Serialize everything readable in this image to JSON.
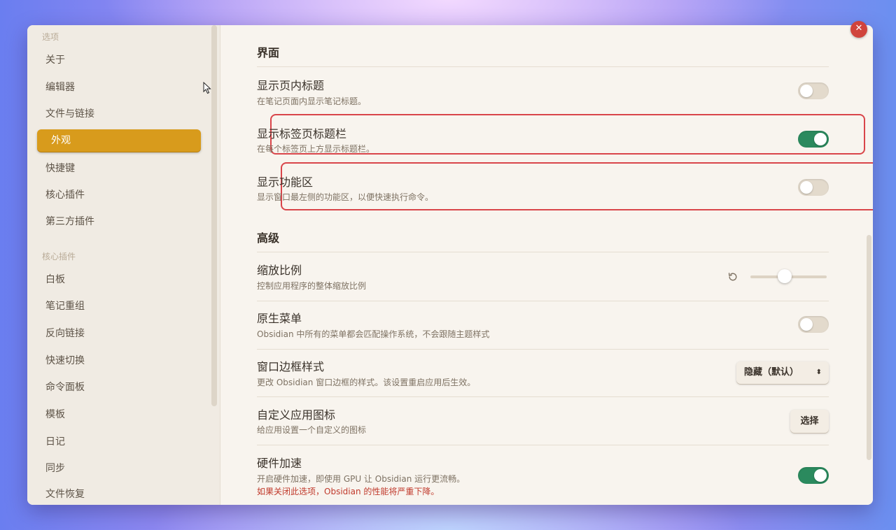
{
  "sidebar": {
    "options_heading": "选项",
    "options_items": [
      {
        "label": "关于"
      },
      {
        "label": "编辑器"
      },
      {
        "label": "文件与链接"
      },
      {
        "label": "外观",
        "active": true
      },
      {
        "label": "快捷键"
      },
      {
        "label": "核心插件"
      },
      {
        "label": "第三方插件"
      }
    ],
    "core_plugins_heading": "核心插件",
    "core_plugin_items": [
      {
        "label": "白板"
      },
      {
        "label": "笔记重组"
      },
      {
        "label": "反向链接"
      },
      {
        "label": "快速切换"
      },
      {
        "label": "命令面板"
      },
      {
        "label": "模板"
      },
      {
        "label": "日记"
      },
      {
        "label": "同步"
      },
      {
        "label": "文件恢复"
      }
    ]
  },
  "content": {
    "interface_group_title": "界面",
    "advanced_group_title": "高级",
    "settings": {
      "inline_title": {
        "name": "显示页内标题",
        "desc": "在笔记页面内显示笔记标题。",
        "enabled": false
      },
      "tab_title_bar": {
        "name": "显示标签页标题栏",
        "desc": "在每个标签页上方显示标题栏。",
        "enabled": true
      },
      "ribbon": {
        "name": "显示功能区",
        "desc": "显示窗口最左侧的功能区，以便快速执行命令。",
        "enabled": false
      },
      "zoom": {
        "name": "缩放比例",
        "desc": "控制应用程序的整体缩放比例",
        "slider_fraction": 0.45
      },
      "native_menus": {
        "name": "原生菜单",
        "desc": "Obsidian 中所有的菜单都会匹配操作系统，不会跟随主题样式",
        "enabled": false
      },
      "frame_style": {
        "name": "窗口边框样式",
        "desc": "更改 Obsidian 窗口边框的样式。该设置重启应用后生效。",
        "selected": "隐藏（默认）"
      },
      "app_icon": {
        "name": "自定义应用图标",
        "desc": "给应用设置一个自定义的图标",
        "button_label": "选择"
      },
      "hw_accel": {
        "name": "硬件加速",
        "desc": "开启硬件加速，即使用 GPU 让 Obsidian 运行更流畅。",
        "warning": "如果关闭此选项，Obsidian 的性能将严重下降。",
        "enabled": true
      }
    }
  },
  "icons": {
    "close": "close-icon",
    "reset": "reset-icon",
    "chevron": "chevron-updown-icon",
    "cursor": "mouse-cursor-icon"
  },
  "colors": {
    "accent": "#d89b1c",
    "toggle_on": "#2b8a5e",
    "highlight_border": "#d9454a",
    "warning_text": "#c0392b"
  }
}
